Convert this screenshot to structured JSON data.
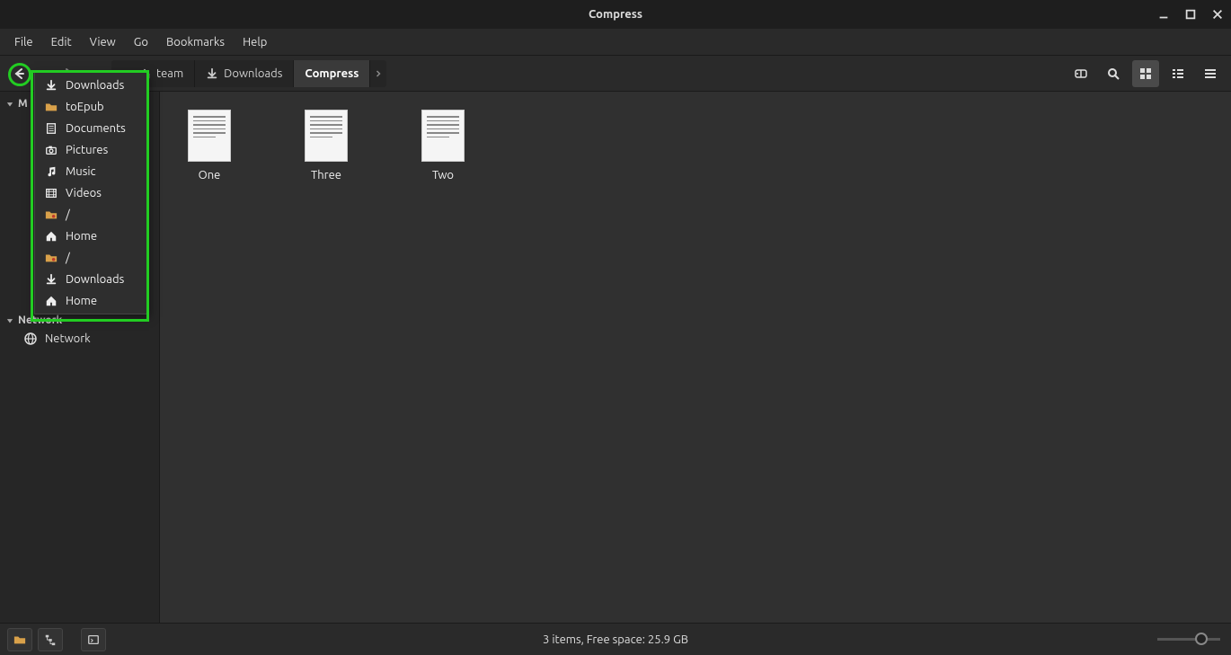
{
  "window": {
    "title": "Compress"
  },
  "menubar": {
    "items": [
      "File",
      "Edit",
      "View",
      "Go",
      "Bookmarks",
      "Help"
    ]
  },
  "breadcrumb": {
    "segments": [
      {
        "label": "team",
        "icon": "home"
      },
      {
        "label": "Downloads",
        "icon": "download"
      },
      {
        "label": "Compress",
        "icon": "",
        "active": true
      }
    ]
  },
  "history_menu": {
    "items": [
      {
        "label": "Downloads",
        "icon": "download"
      },
      {
        "label": "toEpub",
        "icon": "folder"
      },
      {
        "label": "Documents",
        "icon": "document"
      },
      {
        "label": "Pictures",
        "icon": "camera"
      },
      {
        "label": "Music",
        "icon": "music"
      },
      {
        "label": "Videos",
        "icon": "video"
      },
      {
        "label": "/",
        "icon": "folder-root"
      },
      {
        "label": "Home",
        "icon": "home"
      },
      {
        "label": "/",
        "icon": "folder-root"
      },
      {
        "label": "Downloads",
        "icon": "download"
      },
      {
        "label": "Home",
        "icon": "home"
      }
    ]
  },
  "sidebar": {
    "section1_label": "M",
    "network_label": "Network",
    "network_item": "Network"
  },
  "files": {
    "items": [
      {
        "name": "One"
      },
      {
        "name": "Three"
      },
      {
        "name": "Two"
      }
    ]
  },
  "statusbar": {
    "text": "3 items, Free space: 25.9 GB"
  }
}
